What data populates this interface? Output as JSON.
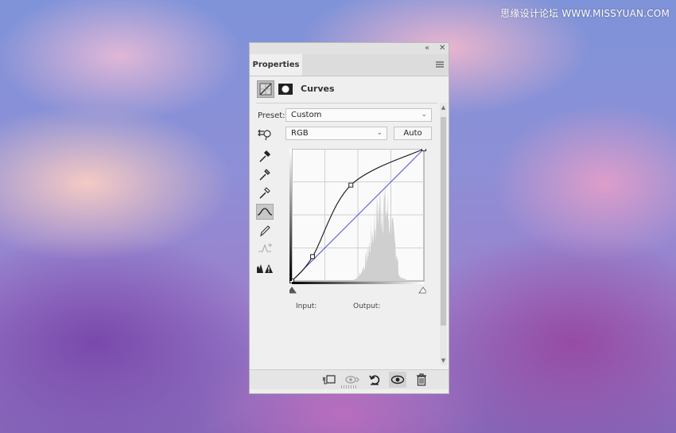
{
  "watermark": "思缘设计论坛 WWW.MISSYUAN.COM",
  "panel": {
    "tab_label": "Properties",
    "title": "Curves",
    "preset_label": "Preset:",
    "preset_value": "Custom",
    "channel_value": "RGB",
    "auto_label": "Auto",
    "input_label": "Input:",
    "output_label": "Output:"
  },
  "icons": {
    "collapse": "double-left-arrow-icon",
    "close": "close-icon",
    "menu": "panel-menu-icon",
    "curves": "curves-adjustment-icon",
    "mask": "layer-mask-icon"
  },
  "curve": {
    "points": [
      [
        0,
        0
      ],
      [
        40,
        47
      ],
      [
        114,
        185
      ],
      [
        255,
        255
      ]
    ],
    "diagonal": [
      [
        0,
        0
      ],
      [
        255,
        255
      ]
    ]
  }
}
